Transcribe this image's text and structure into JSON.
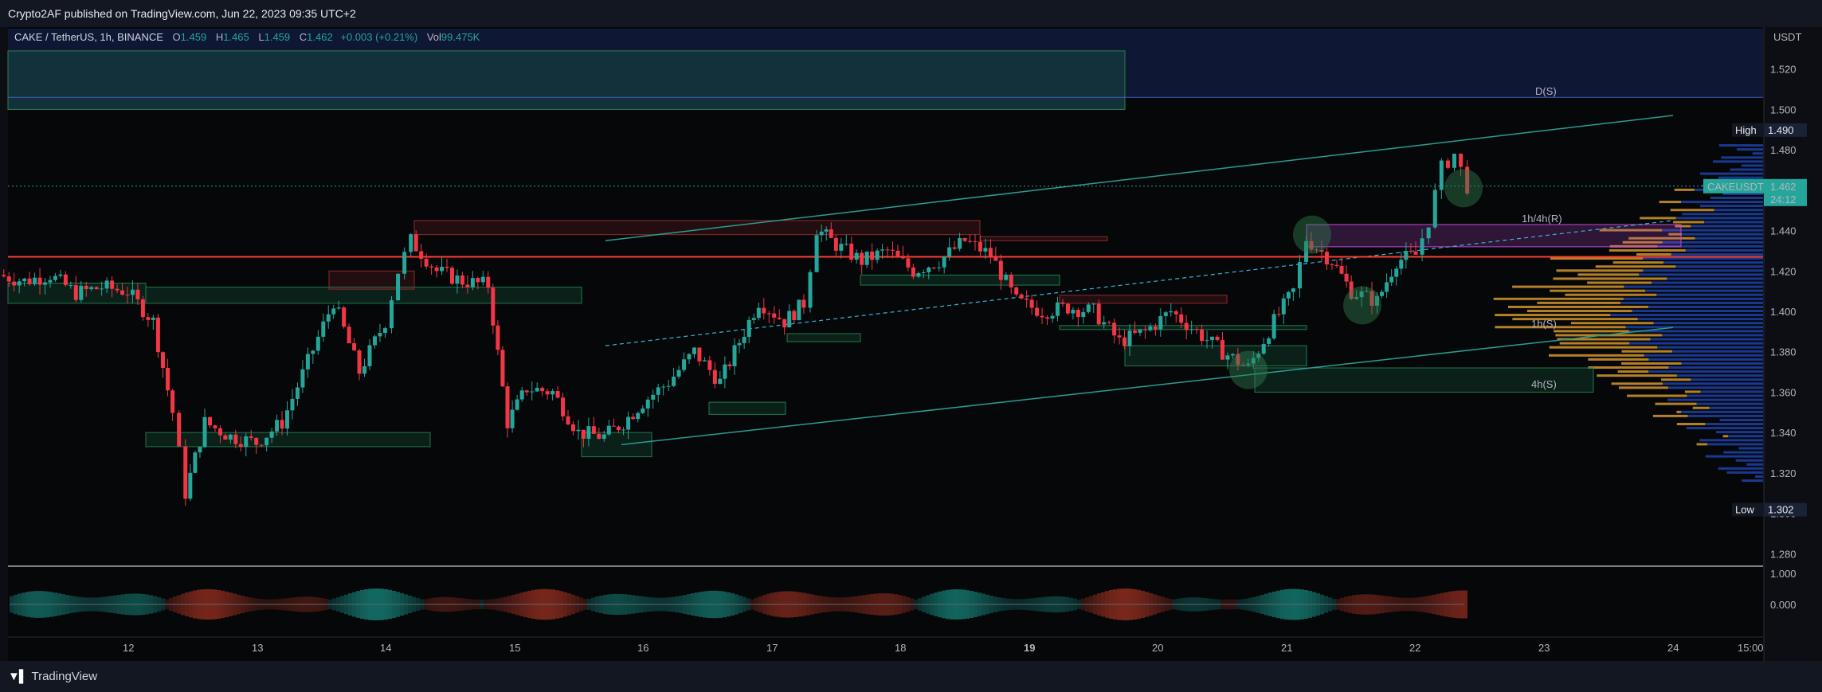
{
  "header": {
    "published_by": "Crypto2AF published on TradingView.com, Jun 22, 2023 09:35 UTC+2"
  },
  "legend": {
    "symbol": "CAKE / TetherUS, 1h, BINANCE",
    "o_label": "O",
    "o_value": "1.459",
    "h_label": "H",
    "h_value": "1.465",
    "l_label": "L",
    "l_value": "1.459",
    "c_label": "C",
    "c_value": "1.462",
    "change": "+0.003 (+0.21%)",
    "vol_label": "Vol",
    "vol_value": "99.475K"
  },
  "price_scale": {
    "currency": "USDT",
    "ticks": [
      "1.520",
      "1.500",
      "1.480",
      "1.460",
      "1.440",
      "1.420",
      "1.400",
      "1.380",
      "1.360",
      "1.340",
      "1.320",
      "1.300",
      "1.280"
    ],
    "high_label": "High",
    "high_value": "1.490",
    "low_label": "Low",
    "low_value": "1.302",
    "symbol_tag": "CAKEUSDT",
    "last_price": "1.462",
    "countdown": "24:12"
  },
  "oscillator_scale": {
    "ticks": [
      "1.000",
      "0.000"
    ]
  },
  "time_axis": [
    "12",
    "13",
    "14",
    "15",
    "16",
    "17",
    "18",
    "19",
    "20",
    "21",
    "22",
    "23",
    "24",
    "15:00"
  ],
  "annotations": [
    "D(S)",
    "1h/4h(R)",
    "1h(S)",
    "4h(S)"
  ],
  "footer": {
    "brand": "TradingView"
  },
  "colors": {
    "up": "#26a69a",
    "down": "#f23645",
    "resistance": "#ff3b30",
    "zone_green": "#1f7a4d",
    "zone_red": "#8a2a2a",
    "channel": "#2a9d8f",
    "profile_blue": "#2962ff",
    "profile_orange": "#e0a030",
    "purple": "#c44bd6"
  },
  "chart_data": {
    "type": "candlestick",
    "symbol": "CAKE / TetherUS",
    "interval": "1h",
    "exchange": "BINANCE",
    "ylim": [
      1.275,
      1.54
    ],
    "x_ticks": [
      "12",
      "13",
      "14",
      "15",
      "16",
      "17",
      "18",
      "19",
      "20",
      "21",
      "22",
      "23",
      "24",
      "15:00"
    ],
    "last": {
      "open": 1.459,
      "high": 1.465,
      "low": 1.459,
      "close": 1.462,
      "change": 0.003,
      "change_pct": 0.21,
      "volume": "99.475K"
    },
    "range_high": 1.49,
    "range_low": 1.302,
    "close_path": [
      [
        11.0,
        1.418
      ],
      [
        11.2,
        1.415
      ],
      [
        11.4,
        1.418
      ],
      [
        11.6,
        1.409
      ],
      [
        11.8,
        1.412
      ],
      [
        12.0,
        1.41
      ],
      [
        12.2,
        1.395
      ],
      [
        12.35,
        1.35
      ],
      [
        12.45,
        1.31
      ],
      [
        12.6,
        1.345
      ],
      [
        12.8,
        1.338
      ],
      [
        13.0,
        1.335
      ],
      [
        13.2,
        1.345
      ],
      [
        13.4,
        1.375
      ],
      [
        13.6,
        1.405
      ],
      [
        13.8,
        1.37
      ],
      [
        14.0,
        1.395
      ],
      [
        14.1,
        1.42
      ],
      [
        14.2,
        1.435
      ],
      [
        14.4,
        1.42
      ],
      [
        14.6,
        1.415
      ],
      [
        14.8,
        1.413
      ],
      [
        14.95,
        1.345
      ],
      [
        15.1,
        1.362
      ],
      [
        15.3,
        1.36
      ],
      [
        15.5,
        1.34
      ],
      [
        15.7,
        1.338
      ],
      [
        15.85,
        1.345
      ],
      [
        16.0,
        1.355
      ],
      [
        16.2,
        1.365
      ],
      [
        16.4,
        1.38
      ],
      [
        16.6,
        1.365
      ],
      [
        16.75,
        1.385
      ],
      [
        16.9,
        1.405
      ],
      [
        17.1,
        1.395
      ],
      [
        17.25,
        1.404
      ],
      [
        17.35,
        1.441
      ],
      [
        17.5,
        1.433
      ],
      [
        17.7,
        1.425
      ],
      [
        17.9,
        1.43
      ],
      [
        18.1,
        1.42
      ],
      [
        18.3,
        1.425
      ],
      [
        18.5,
        1.435
      ],
      [
        18.7,
        1.428
      ],
      [
        18.9,
        1.405
      ],
      [
        19.1,
        1.4
      ],
      [
        19.3,
        1.402
      ],
      [
        19.5,
        1.4
      ],
      [
        19.7,
        1.385
      ],
      [
        19.9,
        1.39
      ],
      [
        20.1,
        1.4
      ],
      [
        20.3,
        1.39
      ],
      [
        20.5,
        1.38
      ],
      [
        20.7,
        1.372
      ],
      [
        20.9,
        1.395
      ],
      [
        21.05,
        1.41
      ],
      [
        21.15,
        1.436
      ],
      [
        21.35,
        1.425
      ],
      [
        21.5,
        1.41
      ],
      [
        21.7,
        1.405
      ],
      [
        21.85,
        1.425
      ],
      [
        22.0,
        1.428
      ],
      [
        22.1,
        1.445
      ],
      [
        22.2,
        1.471
      ],
      [
        22.3,
        1.478
      ],
      [
        22.4,
        1.462
      ]
    ],
    "levels": [
      {
        "label": "D(S)",
        "price": 1.506
      },
      {
        "label": "1h/4h(R)",
        "price": 1.442
      },
      {
        "label": "1h(S)",
        "price": 1.391
      },
      {
        "label": "4h(S)",
        "price": 1.361
      },
      {
        "label": "",
        "price": 1.427
      }
    ]
  }
}
